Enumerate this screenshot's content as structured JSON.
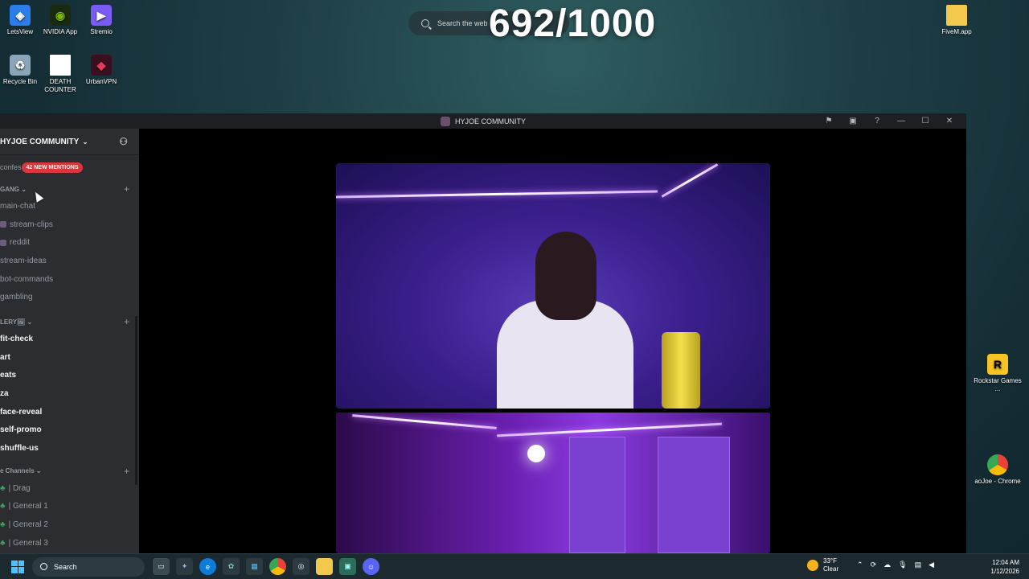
{
  "desktop": {
    "icons_left": [
      {
        "label": "LetsView",
        "color": "#2b7de9",
        "glyph": "◈"
      },
      {
        "label": "NVIDIA App",
        "color": "#76b900",
        "glyph": "◉"
      },
      {
        "label": "Stremio",
        "color": "#7b5bf5",
        "glyph": "▶"
      },
      {
        "label": "Recycle Bin",
        "color": "#8aa4b8",
        "glyph": "♻"
      },
      {
        "label": "DEATH COUNTER",
        "color": "#ffffff",
        "glyph": ""
      },
      {
        "label": "UrbanVPN",
        "color": "#3a1020",
        "glyph": "◆"
      }
    ],
    "icons_right": [
      {
        "label": "FiveM.app",
        "color": "#f2c94c",
        "glyph": "▬"
      },
      {
        "label": "Rockstar Games ...",
        "color": "#f7c325",
        "glyph": "R"
      },
      {
        "label": "aoJoe - Chrome",
        "color": "#4285f4",
        "glyph": "◎"
      }
    ],
    "web_search_placeholder": "Search the web",
    "counter": "692/1000"
  },
  "discord": {
    "window_title": "HYJOE COMMUNITY",
    "server_name": "HYJOE COMMUNITY",
    "mentions_prefix": "confes",
    "mentions_badge": "42 NEW MENTIONS",
    "categories": [
      {
        "name": "GANG",
        "channels": [
          {
            "name": "main-chat",
            "bold": false,
            "tag": false
          },
          {
            "name": "stream-clips",
            "bold": false,
            "tag": true
          },
          {
            "name": "reddit",
            "bold": false,
            "tag": true
          },
          {
            "name": "stream-ideas",
            "bold": false,
            "tag": false
          },
          {
            "name": "bot-commands",
            "bold": false,
            "tag": false
          },
          {
            "name": "gambling",
            "bold": false,
            "tag": false
          }
        ]
      },
      {
        "name": "LERY🖼",
        "channels": [
          {
            "name": "fit-check",
            "bold": true,
            "tag": false
          },
          {
            "name": "art",
            "bold": true,
            "tag": false
          },
          {
            "name": "eats",
            "bold": true,
            "tag": false
          },
          {
            "name": "za",
            "bold": true,
            "tag": false
          },
          {
            "name": "face-reveal",
            "bold": true,
            "tag": false
          },
          {
            "name": "self-promo",
            "bold": true,
            "tag": false
          },
          {
            "name": "shuffle-us",
            "bold": true,
            "tag": false
          }
        ]
      },
      {
        "name": "e Channels",
        "channels": [
          {
            "name": "| Drag",
            "bold": false,
            "voice": true
          },
          {
            "name": "| General 1",
            "bold": false,
            "voice": true
          },
          {
            "name": "| General 2",
            "bold": false,
            "voice": true
          },
          {
            "name": "| General 3",
            "bold": false,
            "voice": true
          }
        ]
      }
    ]
  },
  "taskbar": {
    "search_label": "Search",
    "weather_temp": "33°F",
    "weather_desc": "Clear",
    "time": "12:04 AM",
    "date": "1/12/2026"
  }
}
